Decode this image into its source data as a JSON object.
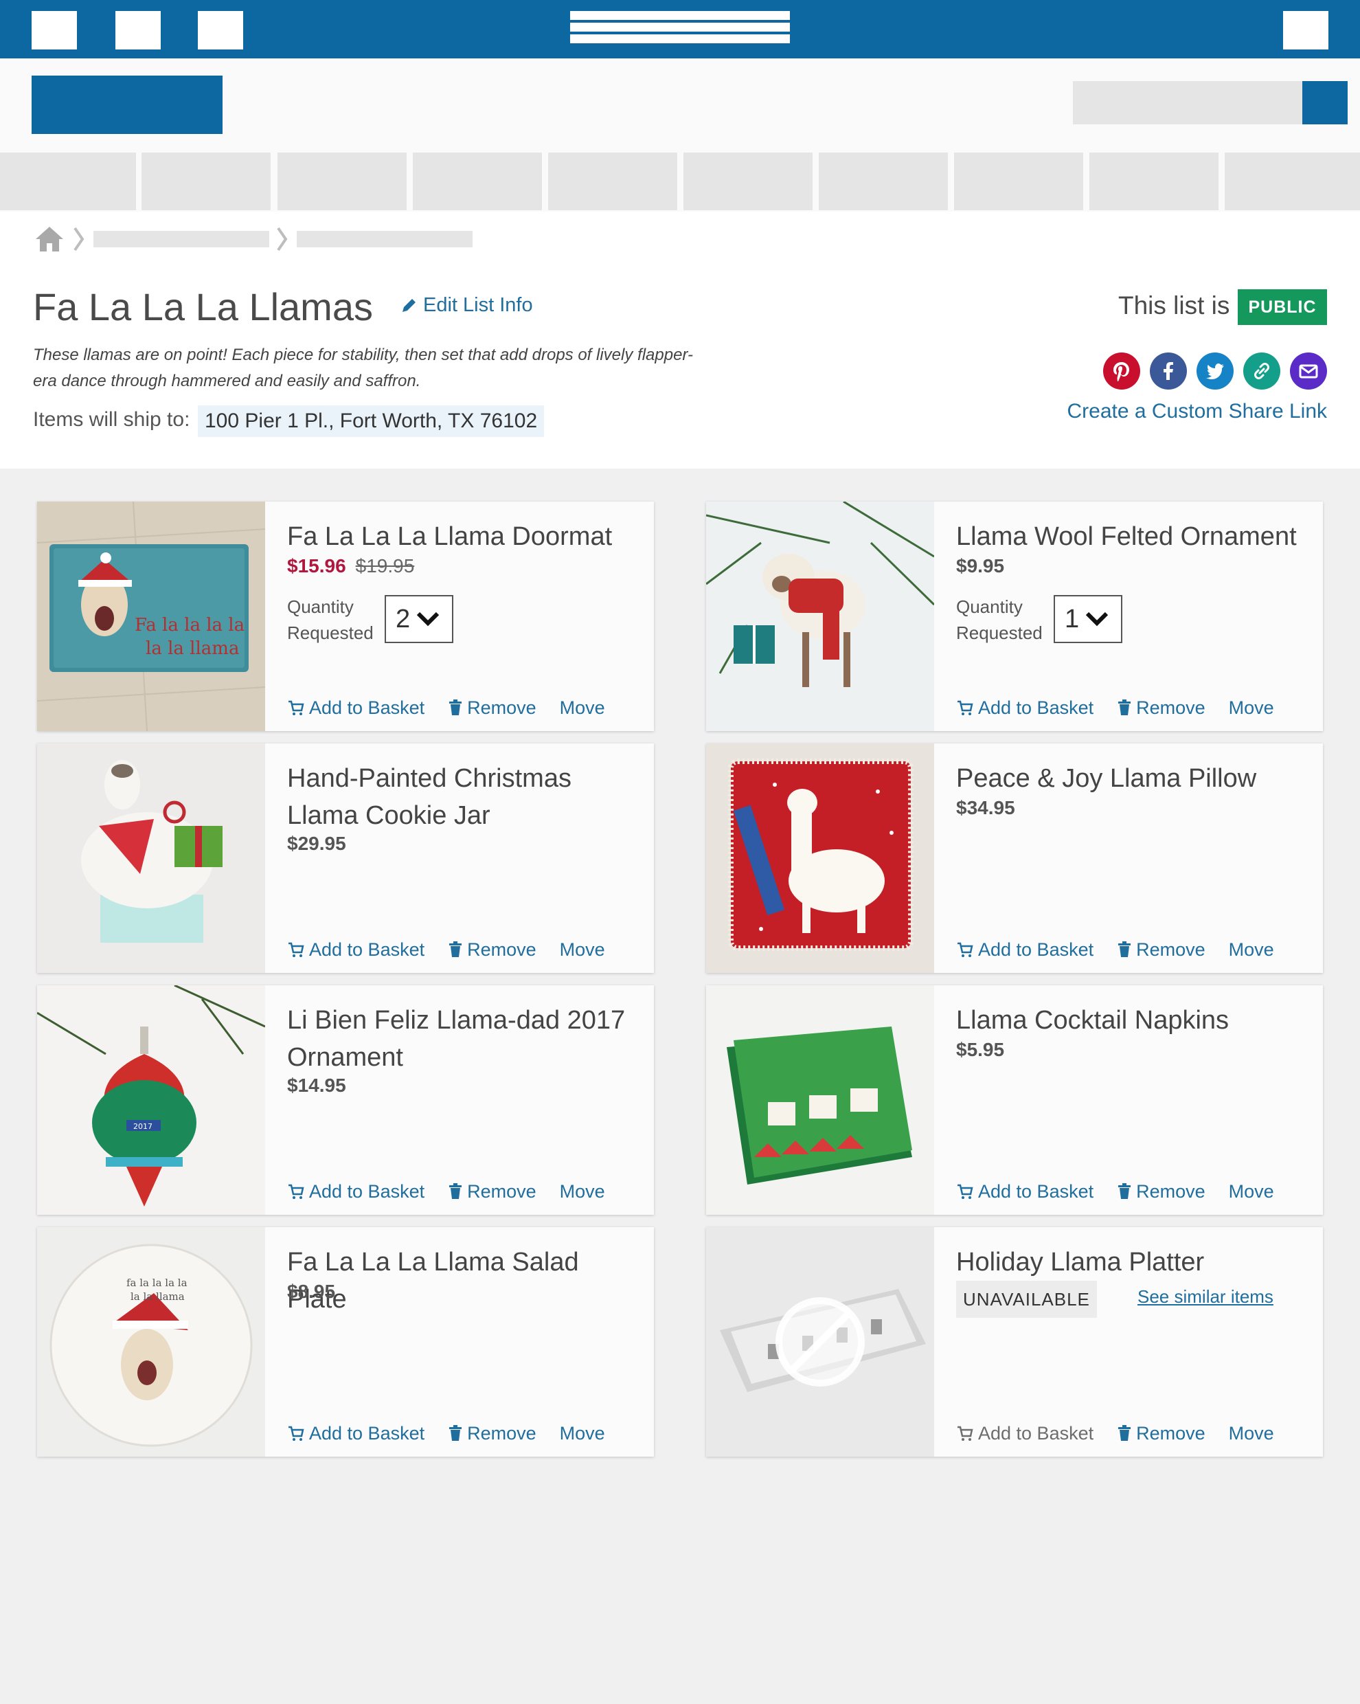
{
  "list": {
    "title": "Fa La La La Llamas",
    "edit_label": "Edit List Info",
    "description": "These llamas are on point! Each piece for stability, then set that add drops of lively flapper-era dance through hammered and easily and saffron.",
    "ship_label": "Items will ship to:",
    "ship_address": "100 Pier 1 Pl., Fort Worth, TX 76102",
    "visibility_label": "This list is",
    "visibility_badge": "PUBLIC",
    "custom_share_label": "Create a Custom Share Link"
  },
  "share_icons": [
    {
      "name": "pinterest-icon",
      "color": "#c8102e"
    },
    {
      "name": "facebook-icon",
      "color": "#3b5998"
    },
    {
      "name": "twitter-icon",
      "color": "#1583c5"
    },
    {
      "name": "link-icon",
      "color": "#139f8a"
    },
    {
      "name": "email-icon",
      "color": "#5b2bc7"
    }
  ],
  "colors": {
    "brand": "#0d67a0",
    "link": "#1f6e9e",
    "sale": "#b1163c",
    "public": "#15985b"
  },
  "actions": {
    "add_to_basket": "Add to Basket",
    "remove": "Remove",
    "move": "Move"
  },
  "quantity_label_1": "Quantity",
  "quantity_label_2": "Requested",
  "items": [
    {
      "title": "Fa La La La Llama Doormat",
      "price": "$15.96",
      "orig_price": "$19.95",
      "quantity": "2"
    },
    {
      "title": "Llama Wool Felted Ornament",
      "price": "$9.95",
      "quantity": "1"
    },
    {
      "title": "Hand-Painted Christmas Llama Cookie Jar",
      "price": "$29.95"
    },
    {
      "title": "Peace & Joy Llama Pillow",
      "price": "$34.95"
    },
    {
      "title": "Li Bien Feliz Llama-dad 2017 Ornament",
      "price": "$14.95"
    },
    {
      "title": "Llama Cocktail Napkins",
      "price": "$5.95"
    },
    {
      "title": "Fa La La La Llama Salad Plate",
      "price": "$8.95"
    },
    {
      "title": "Holiday Llama Platter",
      "status": "UNAVAILABLE",
      "similar_label": "See similar items"
    }
  ]
}
